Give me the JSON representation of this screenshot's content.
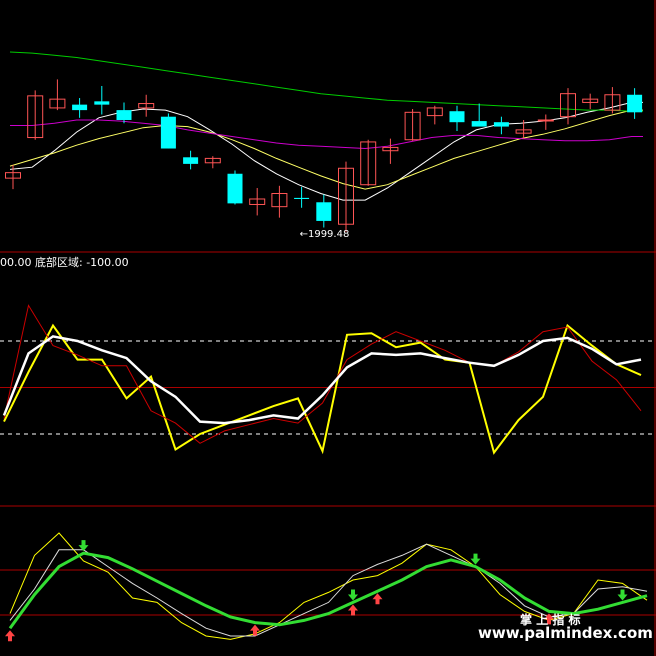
{
  "panel2_header": {
    "prefix": "00.00",
    "name": "底部区域",
    "value": "-100.00"
  },
  "watermark": {
    "cn": "掌 上 指 标",
    "url": "www.palmindex.com"
  },
  "colors": {
    "background": "#000000",
    "up_candle": "#ff5555",
    "down_candle": "#00ffff",
    "panel_divider": "#aa0000",
    "ma_fast": "#ffffff",
    "ma_mid": "#ffff66",
    "ma_long": "#00cc00",
    "ma_slow": "#cc00cc",
    "osc_yellow": "#ffff00",
    "osc_red": "#cc0000",
    "osc_white": "#ffffff",
    "signal_green": "#33dd33",
    "buy_arrow": "#ff4444",
    "sell_arrow": "#33dd33",
    "low_marker": "#cccccc"
  },
  "chart_data": [
    {
      "type": "candlestick",
      "annotations": [
        {
          "text": "←1999.48",
          "bar_index": 13
        }
      ],
      "candles": [
        {
          "o": 2050,
          "h": 2062,
          "l": 2040,
          "c": 2055
        },
        {
          "o": 2087,
          "h": 2130,
          "l": 2085,
          "c": 2125
        },
        {
          "o": 2114,
          "h": 2140,
          "l": 2112,
          "c": 2122
        },
        {
          "o": 2117,
          "h": 2123,
          "l": 2105,
          "c": 2112
        },
        {
          "o": 2120,
          "h": 2134,
          "l": 2108,
          "c": 2117
        },
        {
          "o": 2112,
          "h": 2119,
          "l": 2100,
          "c": 2103
        },
        {
          "o": 2114,
          "h": 2126,
          "l": 2106,
          "c": 2118
        },
        {
          "o": 2106,
          "h": 2109,
          "l": 2077,
          "c": 2077
        },
        {
          "o": 2069,
          "h": 2075,
          "l": 2058,
          "c": 2063
        },
        {
          "o": 2064,
          "h": 2070,
          "l": 2059,
          "c": 2068
        },
        {
          "o": 2054,
          "h": 2057,
          "l": 2026,
          "c": 2027
        },
        {
          "o": 2026,
          "h": 2041,
          "l": 2016,
          "c": 2031
        },
        {
          "o": 2024,
          "h": 2043,
          "l": 2014,
          "c": 2036
        },
        {
          "o": 2032,
          "h": 2042,
          "l": 2023,
          "c": 2031
        },
        {
          "o": 2028,
          "h": 2035,
          "l": 2005,
          "c": 2011
        },
        {
          "o": 2008,
          "h": 2065,
          "l": 2001,
          "c": 2059
        },
        {
          "o": 2044,
          "h": 2085,
          "l": 2043,
          "c": 2083
        },
        {
          "o": 2075,
          "h": 2086,
          "l": 2063,
          "c": 2078
        },
        {
          "o": 2085,
          "h": 2113,
          "l": 2084,
          "c": 2110
        },
        {
          "o": 2107,
          "h": 2116,
          "l": 2099,
          "c": 2114
        },
        {
          "o": 2111,
          "h": 2116,
          "l": 2093,
          "c": 2101
        },
        {
          "o": 2102,
          "h": 2118,
          "l": 2099,
          "c": 2097
        },
        {
          "o": 2101,
          "h": 2106,
          "l": 2090,
          "c": 2097
        },
        {
          "o": 2091,
          "h": 2103,
          "l": 2086,
          "c": 2094
        },
        {
          "o": 2103,
          "h": 2108,
          "l": 2094,
          "c": 2103
        },
        {
          "o": 2106,
          "h": 2132,
          "l": 2099,
          "c": 2127
        },
        {
          "o": 2119,
          "h": 2127,
          "l": 2113,
          "c": 2122
        },
        {
          "o": 2112,
          "h": 2133,
          "l": 2109,
          "c": 2126
        },
        {
          "o": 2126,
          "h": 2132,
          "l": 2104,
          "c": 2110
        }
      ],
      "ma_lines": [
        {
          "name": "ma_fast",
          "values": [
            2058,
            2060,
            2075,
            2092,
            2105,
            2110,
            2113,
            2112,
            2106,
            2094,
            2081,
            2066,
            2054,
            2044,
            2036,
            2030,
            2030,
            2041,
            2055,
            2069,
            2083,
            2094,
            2099,
            2100,
            2102,
            2105,
            2110,
            2114,
            2119
          ]
        },
        {
          "name": "ma_mid",
          "values": [
            2061,
            2067,
            2073,
            2080,
            2086,
            2091,
            2096,
            2098,
            2097,
            2092,
            2085,
            2077,
            2068,
            2060,
            2052,
            2045,
            2040,
            2044,
            2052,
            2060,
            2068,
            2074,
            2080,
            2086,
            2090,
            2095,
            2101,
            2107,
            2112
          ]
        },
        {
          "name": "ma_slow",
          "values": [
            2098,
            2098,
            2100,
            2103,
            2103,
            2102,
            2100,
            2098,
            2094,
            2091,
            2088,
            2085,
            2082,
            2080,
            2079,
            2078,
            2077,
            2079,
            2083,
            2087,
            2089,
            2089,
            2087,
            2086,
            2085,
            2084,
            2084,
            2085,
            2088
          ]
        },
        {
          "name": "ma_long",
          "values": [
            2165,
            2164,
            2162,
            2160,
            2157,
            2154,
            2151,
            2148,
            2145,
            2142,
            2139,
            2136,
            2133,
            2130,
            2127,
            2125,
            2123,
            2121,
            2120,
            2119,
            2118,
            2117,
            2116,
            2115,
            2114,
            2113,
            2112,
            2112,
            2111
          ]
        }
      ]
    },
    {
      "type": "line",
      "title": "底部区域",
      "reference_levels": [
        80,
        50,
        20
      ],
      "series": [
        {
          "name": "yellow",
          "values": [
            28,
            60,
            90,
            68,
            68,
            43,
            57,
            10,
            20,
            26,
            32,
            38,
            43,
            9,
            84,
            85,
            76,
            79,
            68,
            66,
            8,
            29,
            44,
            90,
            77,
            65,
            58
          ]
        },
        {
          "name": "red",
          "values": [
            30,
            103,
            77,
            71,
            64,
            64,
            35,
            27,
            14,
            22,
            26,
            30,
            27,
            40,
            68,
            78,
            86,
            80,
            74,
            66,
            64,
            73,
            86,
            89,
            67,
            55,
            35
          ]
        },
        {
          "name": "white",
          "values": [
            32,
            72,
            83,
            80,
            74,
            69,
            54,
            44,
            28,
            27,
            29,
            32,
            30,
            45,
            63,
            72,
            71,
            72,
            69,
            66,
            64,
            71,
            80,
            82,
            75,
            65,
            68
          ]
        }
      ]
    },
    {
      "type": "line",
      "series": [
        {
          "name": "thin_yellow",
          "values": [
            28,
            80,
            100,
            75,
            65,
            42,
            38,
            20,
            8,
            5,
            10,
            20,
            38,
            47,
            58,
            62,
            73,
            90,
            85,
            70,
            45,
            30,
            22,
            28,
            58,
            55,
            40
          ]
        },
        {
          "name": "thin_white",
          "values": [
            22,
            50,
            85,
            85,
            70,
            55,
            42,
            28,
            15,
            8,
            8,
            18,
            28,
            38,
            62,
            72,
            80,
            90,
            80,
            70,
            55,
            35,
            25,
            28,
            50,
            52,
            48
          ]
        },
        {
          "name": "signal",
          "values": [
            15,
            45,
            70,
            82,
            78,
            68,
            57,
            46,
            35,
            25,
            20,
            18,
            22,
            28,
            38,
            48,
            58,
            70,
            76,
            70,
            58,
            42,
            30,
            28,
            32,
            38,
            44
          ]
        }
      ],
      "buy_signals": [
        0,
        10,
        14,
        15,
        22
      ],
      "sell_signals": [
        3,
        14,
        19,
        25
      ]
    }
  ]
}
